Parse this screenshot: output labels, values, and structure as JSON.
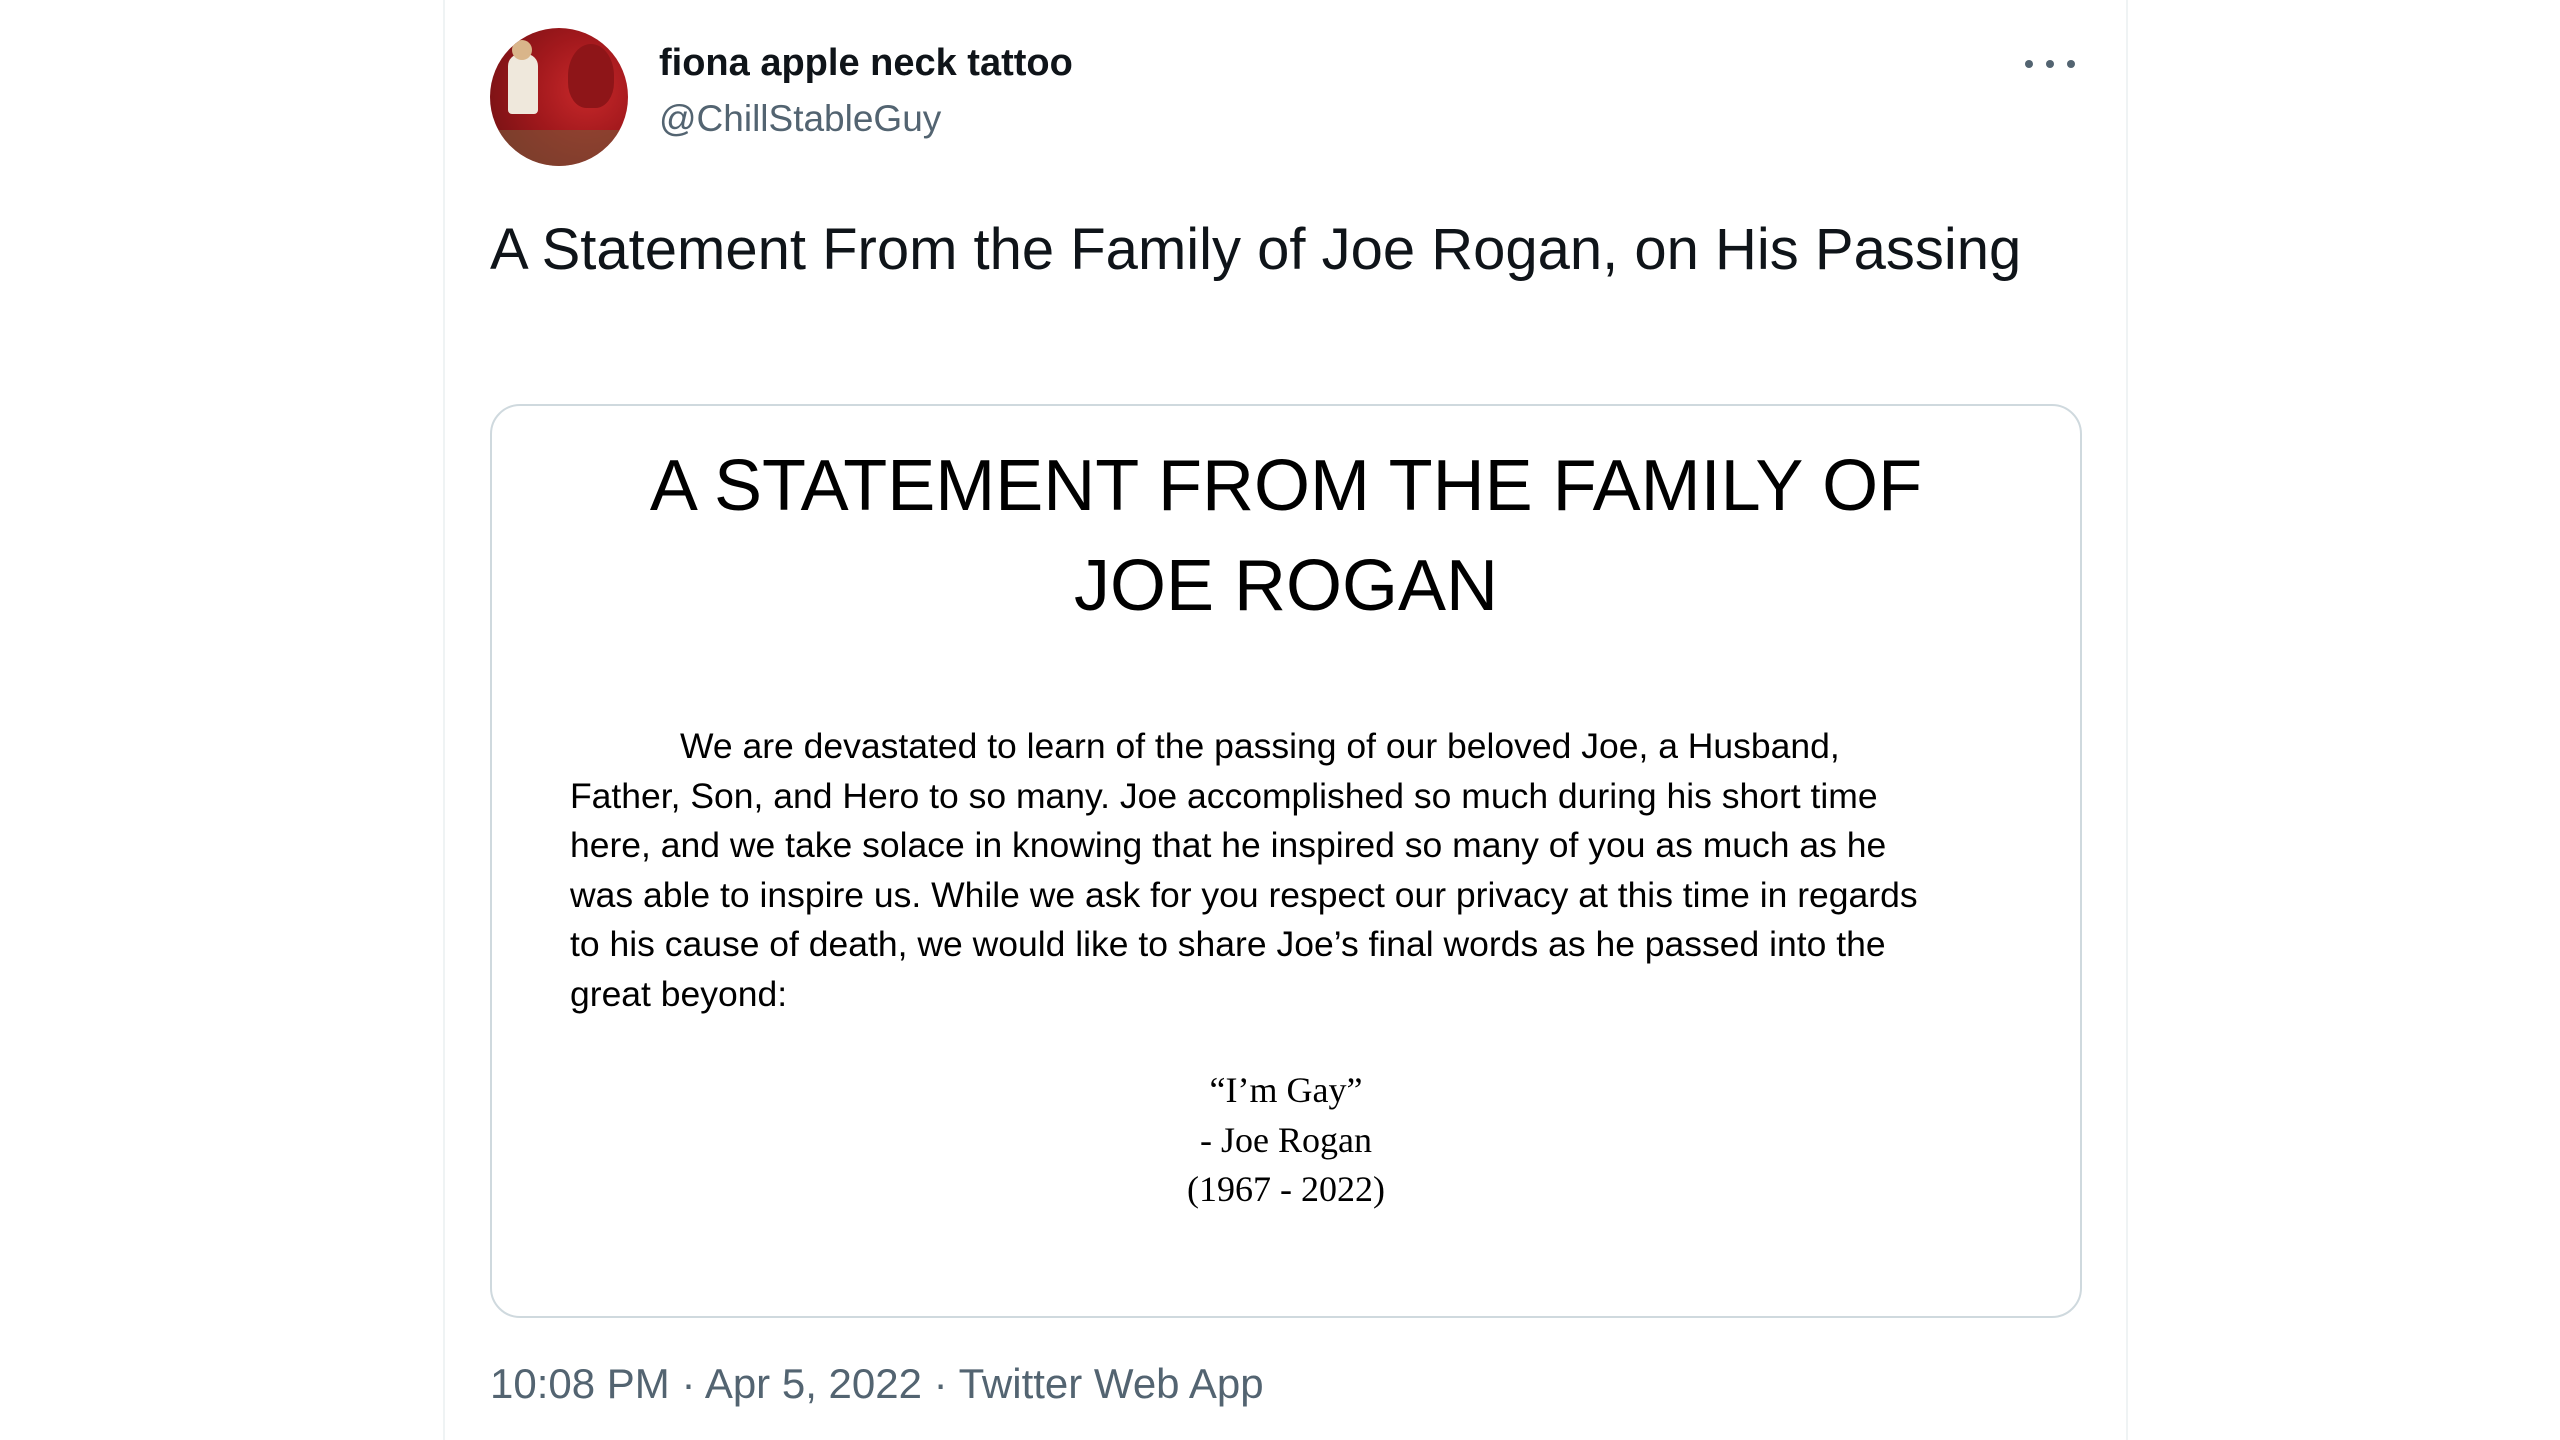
{
  "author": {
    "display_name": "fiona apple neck tattoo",
    "handle": "@ChillStableGuy"
  },
  "tweet": {
    "text": "A Statement From the Family of Joe Rogan, on His Passing"
  },
  "image_card": {
    "title_lines": [
      "A STATEMENT FROM THE FAMILY OF",
      "JOE ROGAN"
    ],
    "body_lines": [
      "We are devastated to learn of the passing of our beloved Joe, a Husband,",
      "Father, Son, and Hero to so many.  Joe accomplished so much during his short time",
      "here, and we take solace in knowing that he inspired so many of you as much as he",
      "was able to inspire us.  While we ask for you respect our privacy at this time in regards",
      "to his cause of death, we would like to share Joe’s final words as he passed into the",
      "great beyond:"
    ],
    "quote": {
      "text": "“I’m Gay”",
      "attribution": "- Joe Rogan",
      "years": "(1967 - 2022)"
    }
  },
  "meta": {
    "time": "10:08 PM",
    "separator": "·",
    "date": "Apr 5, 2022",
    "source": "Twitter Web App"
  },
  "icons": {
    "more": "more-horizontal-icon",
    "avatar": "profile-avatar"
  }
}
